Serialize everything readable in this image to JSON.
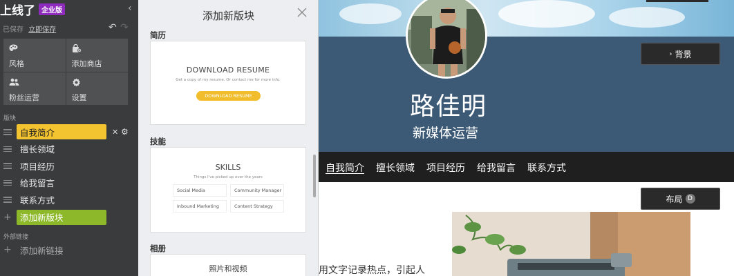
{
  "sidebar": {
    "brand": "上线了",
    "edition_badge": "企业版",
    "saved_status": "已保存",
    "save_now": "立即保存",
    "tools": [
      {
        "label": "风格",
        "icon": "palette-icon"
      },
      {
        "label": "添加商店",
        "icon": "shop-bag-icon"
      },
      {
        "label": "粉丝运营",
        "icon": "users-icon"
      },
      {
        "label": "设置",
        "icon": "gear-icon"
      }
    ],
    "blocks_label": "版块",
    "blocks": [
      {
        "label": "自我简介",
        "active": true
      },
      {
        "label": "擅长领域"
      },
      {
        "label": "项目经历"
      },
      {
        "label": "给我留言"
      },
      {
        "label": "联系方式"
      }
    ],
    "add_block": "添加新版块",
    "external_links_label": "外部链接",
    "add_link": "添加新链接"
  },
  "panel": {
    "title": "添加新版块",
    "categories": [
      {
        "name": "简历",
        "card": {
          "title": "DOWNLOAD RESUME",
          "subtitle": "Get a copy of my resume. Or contact me for more info.",
          "button": "DOWNLOAD RESUME"
        }
      },
      {
        "name": "技能",
        "card": {
          "title": "SKILLS",
          "subtitle": "Things I've picked up over the years",
          "skills": [
            "Social Media",
            "Community Manager",
            "Inbound Marketing",
            "Content Strategy"
          ]
        }
      },
      {
        "name": "相册",
        "card": {
          "title": "照片和视频"
        }
      }
    ]
  },
  "preview": {
    "name": "路佳明",
    "subtitle": "新媒体运营",
    "background_button": "背景",
    "layout_button": "布局",
    "layout_badge": "D",
    "nav": [
      "自我简介",
      "擅长领域",
      "项目经历",
      "给我留言",
      "联系方式"
    ],
    "body_text": "用文字记录热点，引起人"
  },
  "colors": {
    "sidebar_bg": "#3a3b3d",
    "active_block": "#f4c430",
    "add_block": "#8cb82a",
    "badge": "#8e2bbd",
    "banner": "#3c5a75",
    "nav_bg": "#1f1f1f",
    "resume_button": "#f1bd2d"
  }
}
